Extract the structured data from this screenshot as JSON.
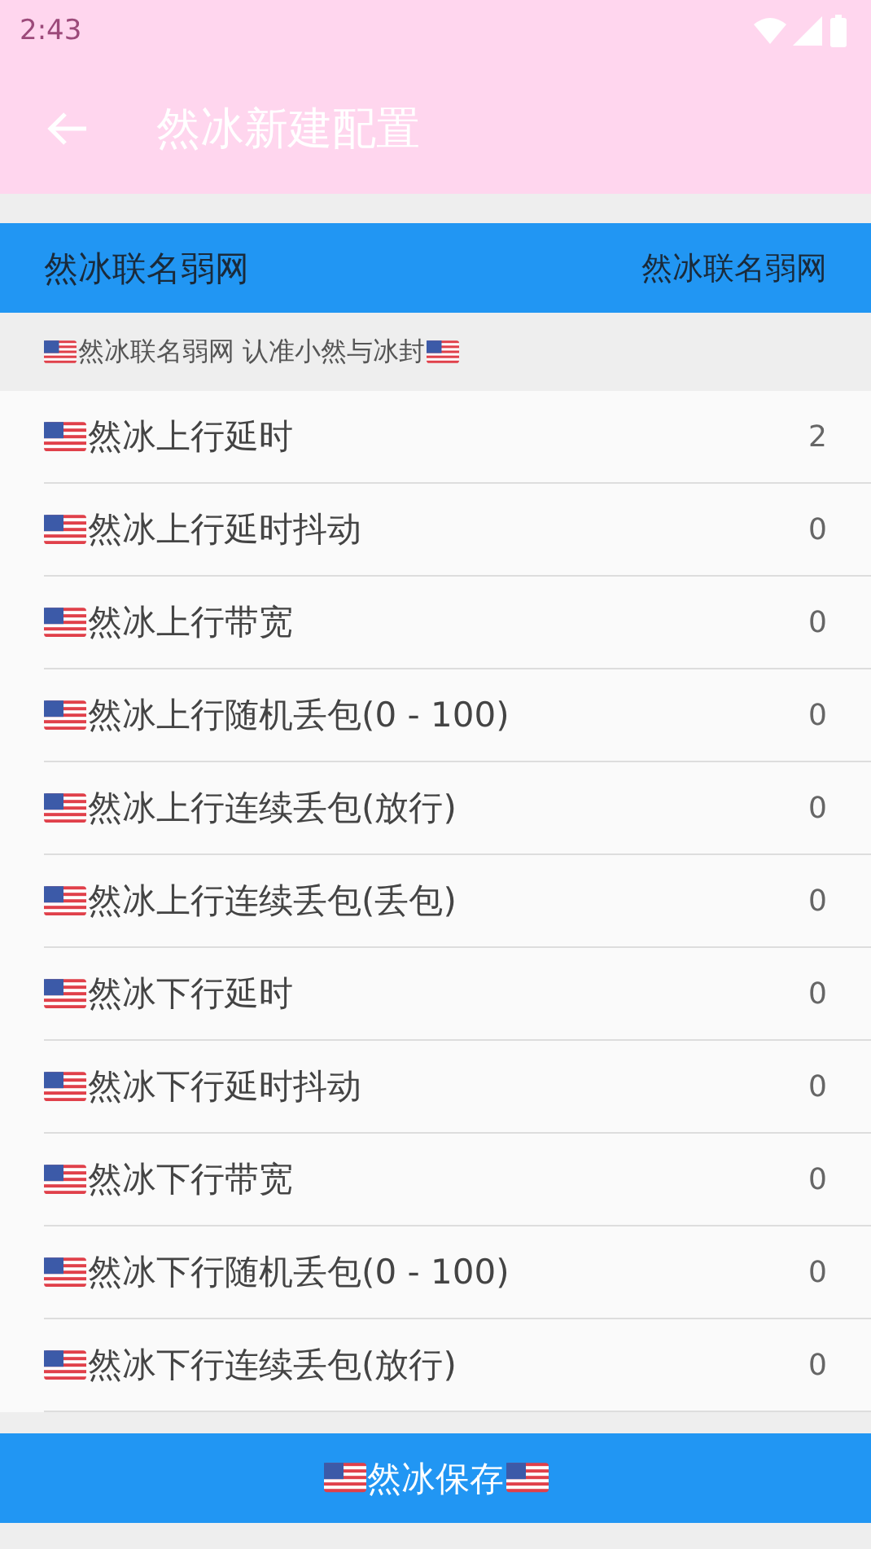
{
  "status_bar": {
    "time": "2:43"
  },
  "app_bar": {
    "title": "然冰新建配置"
  },
  "header": {
    "left": "然冰联名弱网",
    "right": "然冰联名弱网"
  },
  "subheader": {
    "text": "然冰联名弱网 认准小然与冰封"
  },
  "rows": [
    {
      "label": "然冰上行延时",
      "value": "2"
    },
    {
      "label": "然冰上行延时抖动",
      "value": "0"
    },
    {
      "label": "然冰上行带宽",
      "value": "0"
    },
    {
      "label": "然冰上行随机丢包(0 - 100)",
      "value": "0"
    },
    {
      "label": "然冰上行连续丢包(放行)",
      "value": "0"
    },
    {
      "label": "然冰上行连续丢包(丢包)",
      "value": "0"
    },
    {
      "label": "然冰下行延时",
      "value": "0"
    },
    {
      "label": "然冰下行延时抖动",
      "value": "0"
    },
    {
      "label": "然冰下行带宽",
      "value": "0"
    },
    {
      "label": "然冰下行随机丢包(0 - 100)",
      "value": "0"
    },
    {
      "label": "然冰下行连续丢包(放行)",
      "value": "0"
    }
  ],
  "save_button": {
    "label": "然冰保存"
  }
}
